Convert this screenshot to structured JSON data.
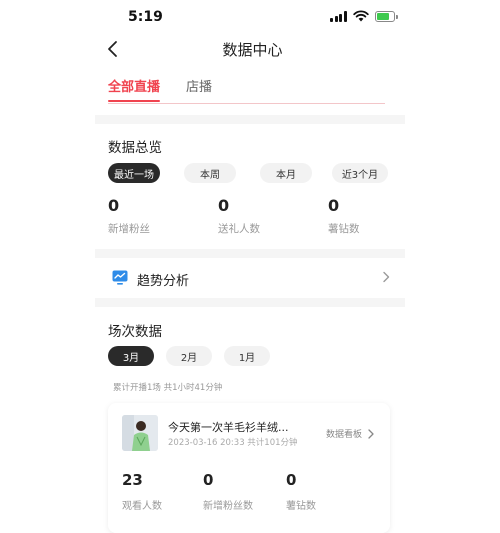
{
  "status_bar": {
    "time": "5:19"
  },
  "nav": {
    "title": "数据中心"
  },
  "tabs": [
    {
      "label": "全部直播",
      "active": true
    },
    {
      "label": "店播",
      "active": false
    }
  ],
  "overview": {
    "title": "数据总览",
    "filters": [
      {
        "label": "最近一场",
        "active": true
      },
      {
        "label": "本周",
        "active": false
      },
      {
        "label": "本月",
        "active": false
      },
      {
        "label": "近3个月",
        "active": false
      }
    ],
    "stats": [
      {
        "value": "0",
        "label": "新增粉丝"
      },
      {
        "value": "0",
        "label": "送礼人数"
      },
      {
        "value": "0",
        "label": "薯钻数"
      }
    ]
  },
  "trend": {
    "label": "趋势分析",
    "icon": "chart-monitor-icon"
  },
  "sessions": {
    "title": "场次数据",
    "months": [
      {
        "label": "3月",
        "active": true
      },
      {
        "label": "2月",
        "active": false
      },
      {
        "label": "1月",
        "active": false
      }
    ],
    "cumulative": "累计开播1场 共1小时41分钟",
    "card": {
      "title": "今天第一次羊毛衫羊绒...",
      "meta": "2023-03-16 20:33  共计101分钟",
      "dashboard_label": "数据看板",
      "stats": [
        {
          "value": "23",
          "label": "观看人数"
        },
        {
          "value": "0",
          "label": "新增粉丝数"
        },
        {
          "value": "0",
          "label": "薯钻数"
        }
      ]
    }
  },
  "colors": {
    "accent": "#f0434f",
    "pill_active": "#2a2a2a",
    "band": "#f5f5f5"
  }
}
